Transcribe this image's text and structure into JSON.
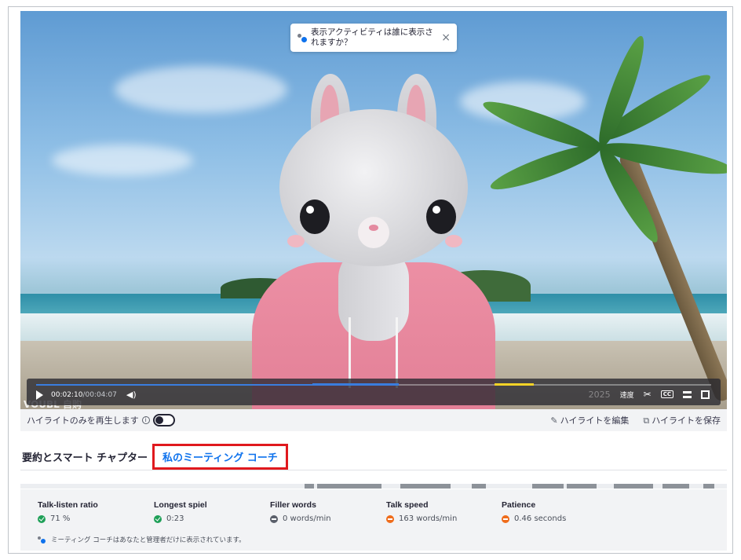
{
  "toast": {
    "message": "表示アクティビティは誰に表示されますか？",
    "close": "×"
  },
  "player": {
    "current_time": "00:02:10",
    "separator": " / ",
    "total_time": "00:04:07",
    "speed_label": "速度",
    "cc_label": "CC",
    "watermark": "VOUBL 自购",
    "date_overlay": "2025",
    "progress_played_fraction": 0.51
  },
  "highlight_bar": {
    "play_highlights_label": "ハイライトのみを再生します",
    "info": "i",
    "edit_highlights": "ハイライトを編集",
    "save_highlights": "ハイライトを保存"
  },
  "tabs": [
    {
      "label": "要約とスマート チャプター",
      "active": false
    },
    {
      "label": "私のミーティング コーチ",
      "active": true
    }
  ],
  "metrics": [
    {
      "title": "Talk-listen ratio",
      "value": "71 %",
      "status": "ok"
    },
    {
      "title": "Longest spiel",
      "value": "0:23",
      "status": "ok"
    },
    {
      "title": "Filler words",
      "value": "0 words/min",
      "status": "neutral"
    },
    {
      "title": "Talk speed",
      "value": "163 words/min",
      "status": "warn"
    },
    {
      "title": "Patience",
      "value": "0.46 seconds",
      "status": "warn"
    }
  ],
  "privacy_note": "ミーティング コーチはあなたと管理者だけに表示されています。",
  "colors": {
    "accent": "#0e72ed",
    "highlight_box": "#e0191e",
    "ok": "#1fa058",
    "warn": "#ef6c1b"
  }
}
